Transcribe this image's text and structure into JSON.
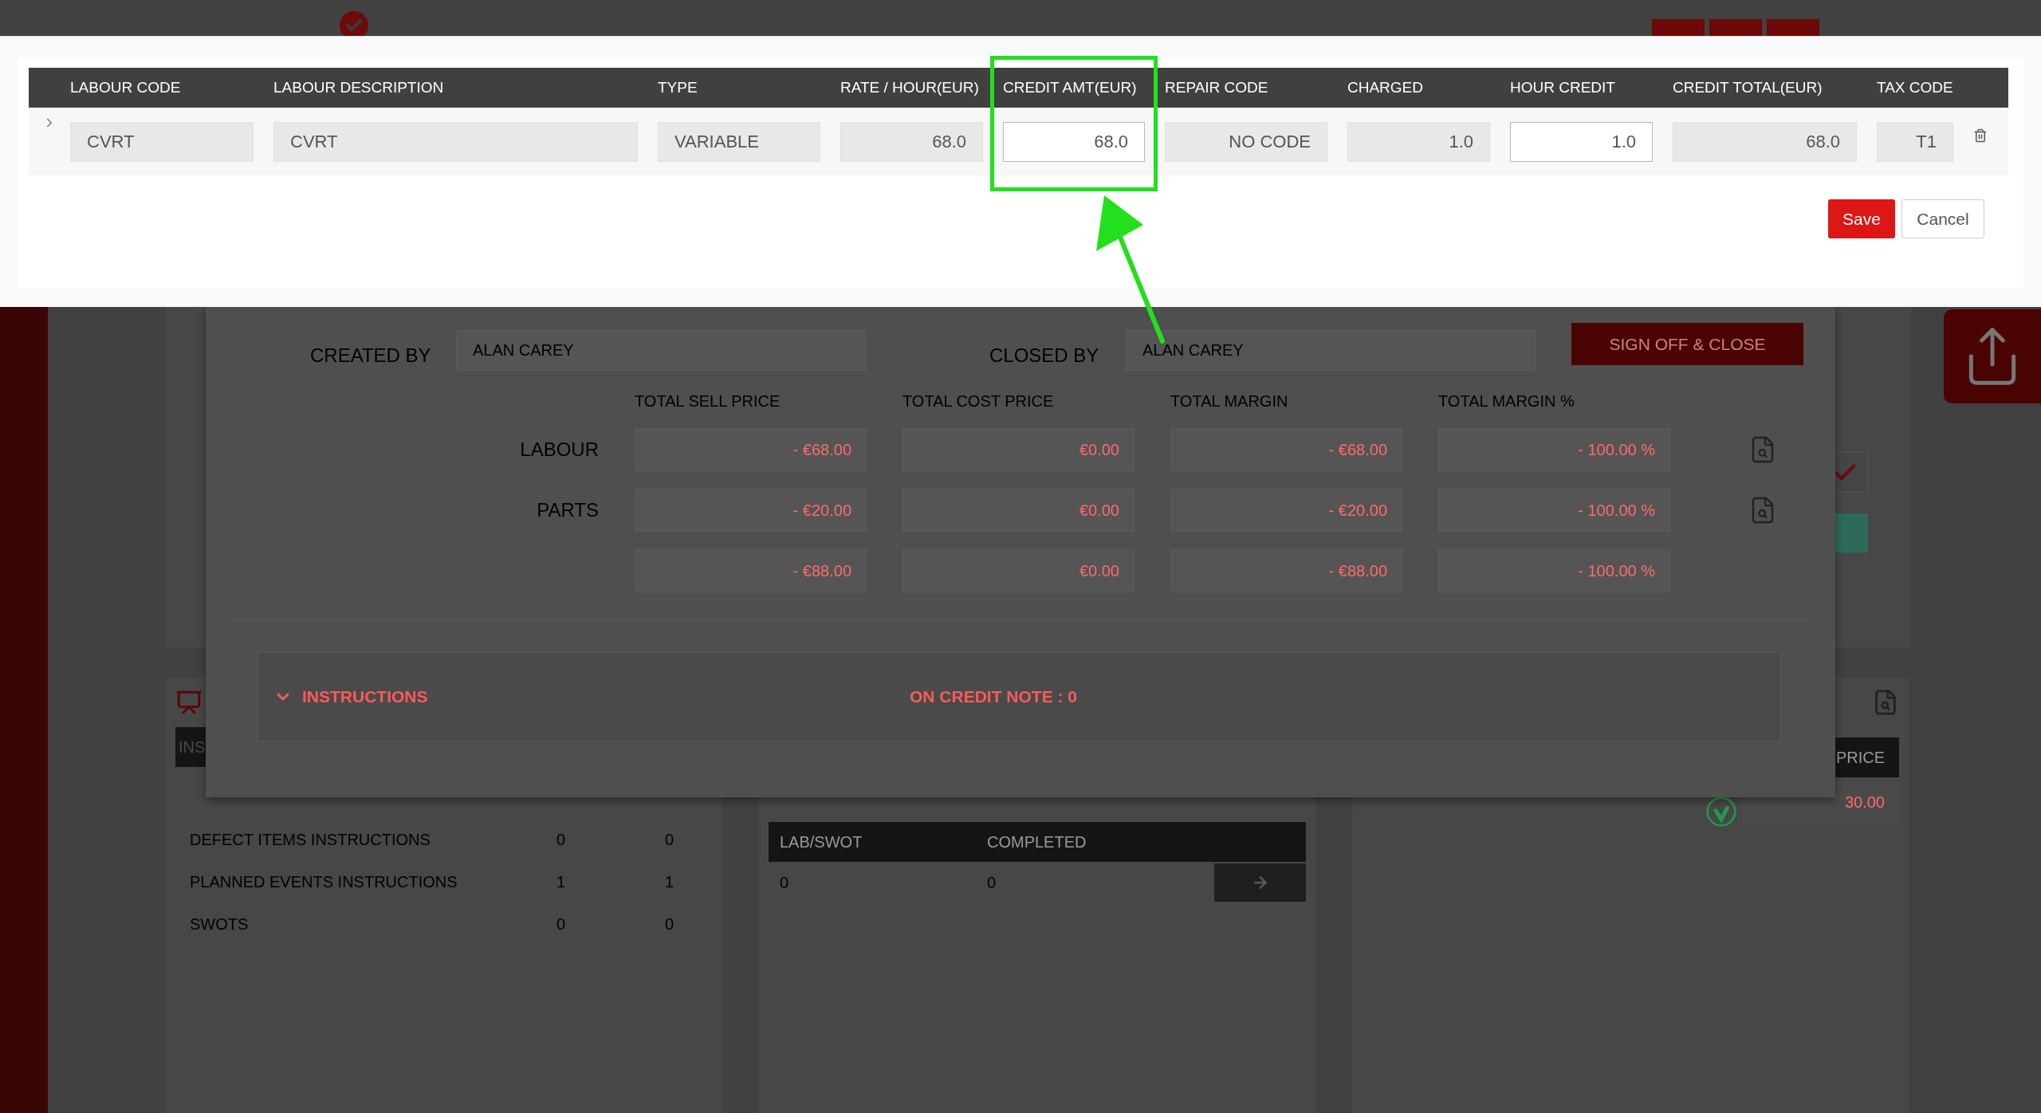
{
  "modal": {
    "columns": [
      {
        "label": "LABOUR CODE",
        "highlighted": false
      },
      {
        "label": "LABOUR DESCRIPTION",
        "highlighted": false
      },
      {
        "label": "TYPE",
        "highlighted": false
      },
      {
        "label": "RATE / HOUR(EUR)",
        "highlighted": false
      },
      {
        "label": "CREDIT AMT(EUR)",
        "highlighted": true
      },
      {
        "label": "REPAIR CODE",
        "highlighted": false
      },
      {
        "label": "CHARGED",
        "highlighted": false
      },
      {
        "label": "HOUR CREDIT",
        "highlighted": false
      },
      {
        "label": "CREDIT TOTAL(EUR)",
        "highlighted": false
      },
      {
        "label": "TAX CODE",
        "highlighted": false
      }
    ],
    "rows": [
      {
        "expanded": false,
        "cells": [
          {
            "value": "CVRT",
            "kind": "text",
            "editable": false
          },
          {
            "value": "CVRT",
            "kind": "text",
            "editable": false
          },
          {
            "value": "VARIABLE",
            "kind": "text",
            "editable": false
          },
          {
            "value": "68.0",
            "kind": "number",
            "editable": false
          },
          {
            "value": "68.0",
            "kind": "number",
            "editable": true
          },
          {
            "value": "NO CODE",
            "kind": "number",
            "editable": false
          },
          {
            "value": "1.0",
            "kind": "number",
            "editable": false
          },
          {
            "value": "1.0",
            "kind": "number",
            "editable": true
          },
          {
            "value": "68.0",
            "kind": "number",
            "editable": false
          },
          {
            "value": "T1",
            "kind": "number",
            "editable": false
          }
        ]
      }
    ],
    "save": "Save",
    "cancel": "Cancel"
  },
  "dialog": {
    "created_by_label": "CREATED BY",
    "created_by": "ALAN CAREY",
    "closed_by_label": "CLOSED BY",
    "closed_by": "ALAN CAREY",
    "sign_off": "SIGN OFF & CLOSE",
    "columns": [
      "TOTAL SELL PRICE",
      "TOTAL COST PRICE",
      "TOTAL MARGIN",
      "TOTAL MARGIN %"
    ],
    "rows": [
      {
        "label": "LABOUR",
        "values": [
          "- €68.00",
          "€0.00",
          "- €68.00",
          "- 100.00 %"
        ]
      },
      {
        "label": "PARTS",
        "values": [
          "- €20.00",
          "€0.00",
          "- €20.00",
          "- 100.00 %"
        ]
      },
      {
        "values": [
          "- €88.00",
          "€0.00",
          "- €88.00",
          "- 100.00 %"
        ]
      }
    ],
    "instructions": {
      "title": "INSTRUCTIONS",
      "expanded": true,
      "credit_note": "ON CREDIT NOTE : 0"
    }
  },
  "background": {
    "instructions_header": "INS",
    "instruction_rows": [
      [
        "DEFECT ITEMS INSTRUCTIONS",
        "0",
        "0"
      ],
      [
        "PLANNED EVENTS INSTRUCTIONS",
        "1",
        "1"
      ],
      [
        "SWOTS",
        "0",
        "0"
      ]
    ],
    "lab_swot": {
      "columns": [
        "LAB/SWOT",
        "COMPLETED"
      ],
      "rows": [
        [
          "0",
          "0"
        ]
      ]
    },
    "price": {
      "column": "PRICE",
      "value": "30.00"
    }
  }
}
